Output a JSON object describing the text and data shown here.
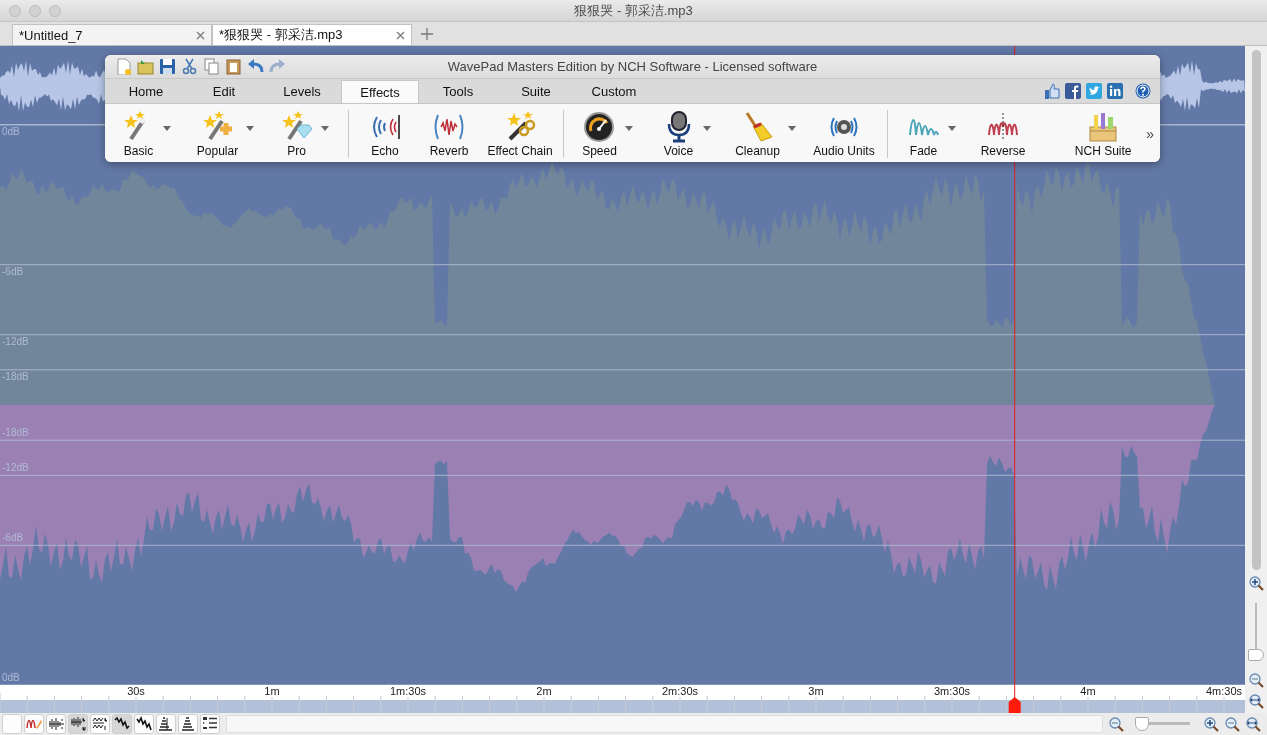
{
  "window": {
    "title": "狠狠哭 - 郭采洁.mp3"
  },
  "tabs": [
    {
      "label": "*Untitled_7",
      "selected": false
    },
    {
      "label": "*狠狠哭 - 郭采洁.mp3",
      "selected": true
    }
  ],
  "toolbar_window": {
    "title": "WavePad Masters Edition by NCH Software - Licensed software",
    "ribbon_tabs": [
      {
        "label": "Home",
        "selected": false
      },
      {
        "label": "Edit",
        "selected": false
      },
      {
        "label": "Levels",
        "selected": false
      },
      {
        "label": "Effects",
        "selected": true
      },
      {
        "label": "Tools",
        "selected": false
      },
      {
        "label": "Suite",
        "selected": false
      },
      {
        "label": "Custom",
        "selected": false
      }
    ],
    "ribbon_groups": [
      [
        {
          "label": "Basic",
          "kind": "wand",
          "dropdown": true
        },
        {
          "label": "Popular",
          "kind": "wandplus",
          "dropdown": true
        },
        {
          "label": "Pro",
          "kind": "wandgem",
          "dropdown": true
        }
      ],
      [
        {
          "label": "Echo",
          "kind": "echo",
          "dropdown": false
        },
        {
          "label": "Reverb",
          "kind": "reverb",
          "dropdown": false
        },
        {
          "label": "Effect Chain",
          "kind": "chain",
          "dropdown": false
        }
      ],
      [
        {
          "label": "Speed",
          "kind": "gauge",
          "dropdown": true
        },
        {
          "label": "Voice",
          "kind": "mic",
          "dropdown": true
        },
        {
          "label": "Cleanup",
          "kind": "broom",
          "dropdown": true
        },
        {
          "label": "Audio Units",
          "kind": "speaker",
          "dropdown": false
        }
      ],
      [
        {
          "label": "Fade",
          "kind": "fade",
          "dropdown": true
        },
        {
          "label": "Reverse",
          "kind": "reverse",
          "dropdown": false
        },
        {
          "label": "NCH Suite",
          "kind": "toolbox",
          "dropdown": false
        }
      ]
    ],
    "overflow": "»"
  },
  "channels": [
    {
      "db_labels": [
        "0dB",
        "-6dB",
        "-12dB",
        "-18dB"
      ]
    },
    {
      "db_labels": [
        "-18dB",
        "-12dB",
        "-6dB",
        "0dB"
      ]
    }
  ],
  "timeline": {
    "labels": [
      "30s",
      "1m",
      "1m:30s",
      "2m",
      "2m:30s",
      "3m",
      "3m:30s",
      "4m",
      "4m:30s"
    ],
    "playhead": {
      "level": 0.815
    }
  },
  "bottom_bar": {
    "view_buttons": [
      {
        "kind": "blank",
        "selected": false
      },
      {
        "kind": "draw",
        "selected": false
      },
      {
        "kind": "markers",
        "selected": false
      },
      {
        "kind": "splitlr",
        "selected": true
      },
      {
        "kind": "stacklr",
        "selected": false
      },
      {
        "kind": "wavea",
        "selected": true
      },
      {
        "kind": "waveb",
        "selected": false
      },
      {
        "kind": "speca",
        "selected": false
      },
      {
        "kind": "specb",
        "selected": false
      },
      {
        "kind": "list",
        "selected": false
      }
    ],
    "zoom": {
      "level": 0.08
    }
  },
  "vertical_zoom": {
    "level": 0.1
  }
}
